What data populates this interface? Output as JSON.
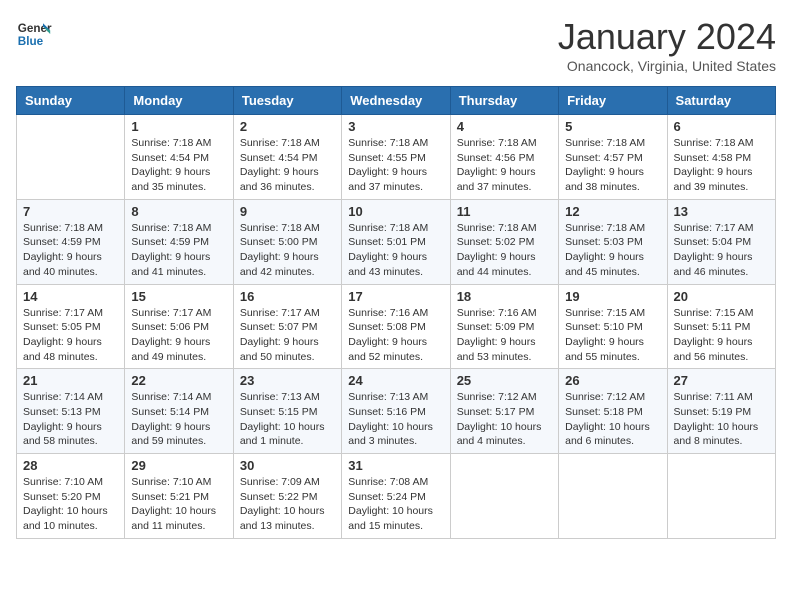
{
  "header": {
    "logo_line1": "General",
    "logo_line2": "Blue",
    "month": "January 2024",
    "location": "Onancock, Virginia, United States"
  },
  "days_of_week": [
    "Sunday",
    "Monday",
    "Tuesday",
    "Wednesday",
    "Thursday",
    "Friday",
    "Saturday"
  ],
  "weeks": [
    [
      {
        "day": "",
        "info": ""
      },
      {
        "day": "1",
        "info": "Sunrise: 7:18 AM\nSunset: 4:54 PM\nDaylight: 9 hours\nand 35 minutes."
      },
      {
        "day": "2",
        "info": "Sunrise: 7:18 AM\nSunset: 4:54 PM\nDaylight: 9 hours\nand 36 minutes."
      },
      {
        "day": "3",
        "info": "Sunrise: 7:18 AM\nSunset: 4:55 PM\nDaylight: 9 hours\nand 37 minutes."
      },
      {
        "day": "4",
        "info": "Sunrise: 7:18 AM\nSunset: 4:56 PM\nDaylight: 9 hours\nand 37 minutes."
      },
      {
        "day": "5",
        "info": "Sunrise: 7:18 AM\nSunset: 4:57 PM\nDaylight: 9 hours\nand 38 minutes."
      },
      {
        "day": "6",
        "info": "Sunrise: 7:18 AM\nSunset: 4:58 PM\nDaylight: 9 hours\nand 39 minutes."
      }
    ],
    [
      {
        "day": "7",
        "info": "Sunrise: 7:18 AM\nSunset: 4:59 PM\nDaylight: 9 hours\nand 40 minutes."
      },
      {
        "day": "8",
        "info": "Sunrise: 7:18 AM\nSunset: 4:59 PM\nDaylight: 9 hours\nand 41 minutes."
      },
      {
        "day": "9",
        "info": "Sunrise: 7:18 AM\nSunset: 5:00 PM\nDaylight: 9 hours\nand 42 minutes."
      },
      {
        "day": "10",
        "info": "Sunrise: 7:18 AM\nSunset: 5:01 PM\nDaylight: 9 hours\nand 43 minutes."
      },
      {
        "day": "11",
        "info": "Sunrise: 7:18 AM\nSunset: 5:02 PM\nDaylight: 9 hours\nand 44 minutes."
      },
      {
        "day": "12",
        "info": "Sunrise: 7:18 AM\nSunset: 5:03 PM\nDaylight: 9 hours\nand 45 minutes."
      },
      {
        "day": "13",
        "info": "Sunrise: 7:17 AM\nSunset: 5:04 PM\nDaylight: 9 hours\nand 46 minutes."
      }
    ],
    [
      {
        "day": "14",
        "info": "Sunrise: 7:17 AM\nSunset: 5:05 PM\nDaylight: 9 hours\nand 48 minutes."
      },
      {
        "day": "15",
        "info": "Sunrise: 7:17 AM\nSunset: 5:06 PM\nDaylight: 9 hours\nand 49 minutes."
      },
      {
        "day": "16",
        "info": "Sunrise: 7:17 AM\nSunset: 5:07 PM\nDaylight: 9 hours\nand 50 minutes."
      },
      {
        "day": "17",
        "info": "Sunrise: 7:16 AM\nSunset: 5:08 PM\nDaylight: 9 hours\nand 52 minutes."
      },
      {
        "day": "18",
        "info": "Sunrise: 7:16 AM\nSunset: 5:09 PM\nDaylight: 9 hours\nand 53 minutes."
      },
      {
        "day": "19",
        "info": "Sunrise: 7:15 AM\nSunset: 5:10 PM\nDaylight: 9 hours\nand 55 minutes."
      },
      {
        "day": "20",
        "info": "Sunrise: 7:15 AM\nSunset: 5:11 PM\nDaylight: 9 hours\nand 56 minutes."
      }
    ],
    [
      {
        "day": "21",
        "info": "Sunrise: 7:14 AM\nSunset: 5:13 PM\nDaylight: 9 hours\nand 58 minutes."
      },
      {
        "day": "22",
        "info": "Sunrise: 7:14 AM\nSunset: 5:14 PM\nDaylight: 9 hours\nand 59 minutes."
      },
      {
        "day": "23",
        "info": "Sunrise: 7:13 AM\nSunset: 5:15 PM\nDaylight: 10 hours\nand 1 minute."
      },
      {
        "day": "24",
        "info": "Sunrise: 7:13 AM\nSunset: 5:16 PM\nDaylight: 10 hours\nand 3 minutes."
      },
      {
        "day": "25",
        "info": "Sunrise: 7:12 AM\nSunset: 5:17 PM\nDaylight: 10 hours\nand 4 minutes."
      },
      {
        "day": "26",
        "info": "Sunrise: 7:12 AM\nSunset: 5:18 PM\nDaylight: 10 hours\nand 6 minutes."
      },
      {
        "day": "27",
        "info": "Sunrise: 7:11 AM\nSunset: 5:19 PM\nDaylight: 10 hours\nand 8 minutes."
      }
    ],
    [
      {
        "day": "28",
        "info": "Sunrise: 7:10 AM\nSunset: 5:20 PM\nDaylight: 10 hours\nand 10 minutes."
      },
      {
        "day": "29",
        "info": "Sunrise: 7:10 AM\nSunset: 5:21 PM\nDaylight: 10 hours\nand 11 minutes."
      },
      {
        "day": "30",
        "info": "Sunrise: 7:09 AM\nSunset: 5:22 PM\nDaylight: 10 hours\nand 13 minutes."
      },
      {
        "day": "31",
        "info": "Sunrise: 7:08 AM\nSunset: 5:24 PM\nDaylight: 10 hours\nand 15 minutes."
      },
      {
        "day": "",
        "info": ""
      },
      {
        "day": "",
        "info": ""
      },
      {
        "day": "",
        "info": ""
      }
    ]
  ]
}
